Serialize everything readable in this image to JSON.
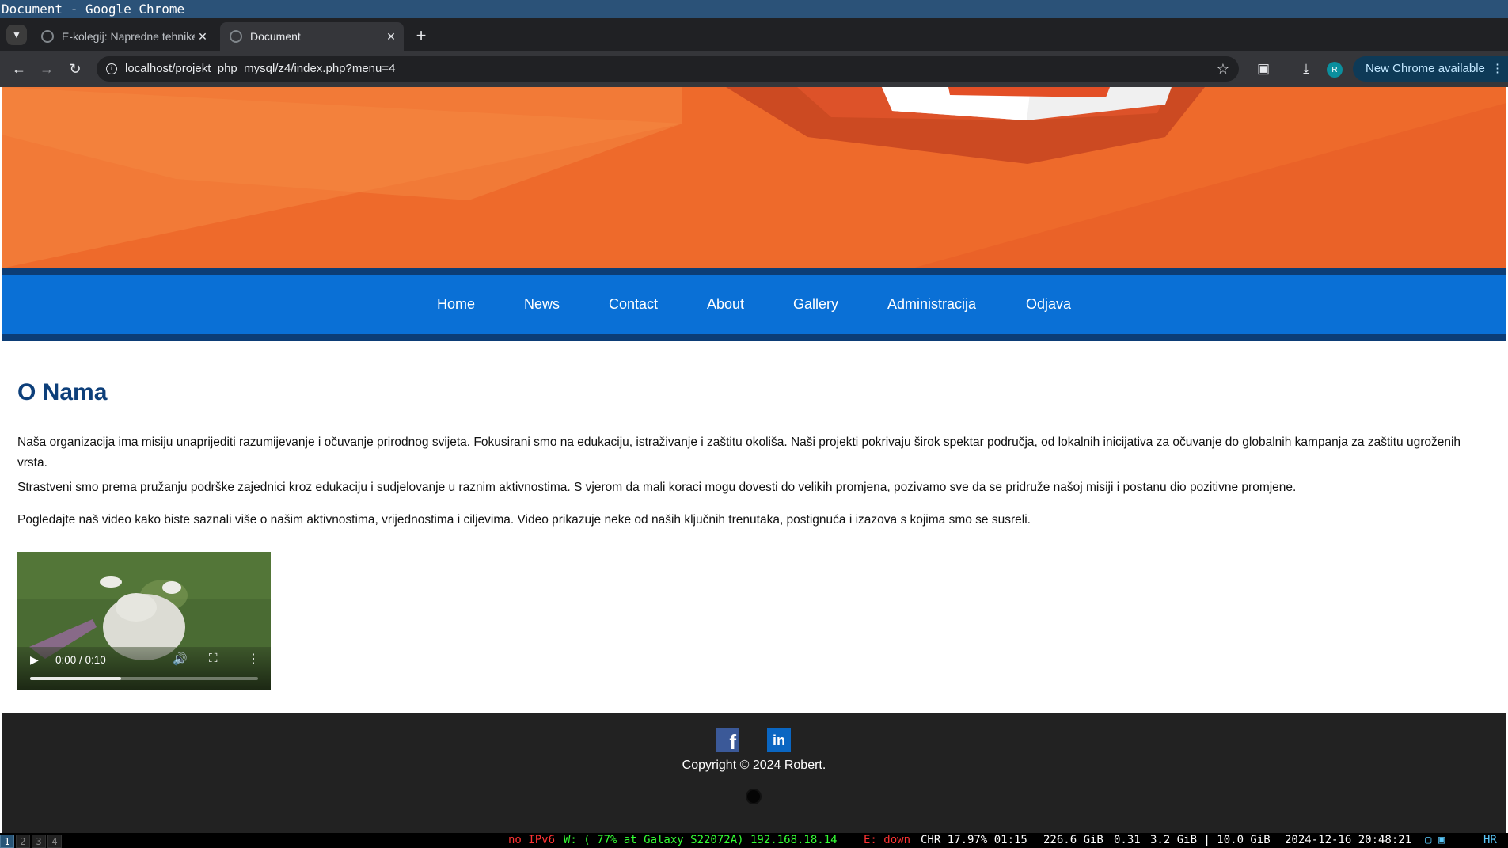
{
  "window": {
    "title": "Document - Google Chrome"
  },
  "tabs": [
    {
      "label": "E-kolegij: Napredne tehnike"
    },
    {
      "label": "Document"
    }
  ],
  "toolbar": {
    "url": "localhost/projekt_php_mysql/z4/index.php?menu=4",
    "profile_initial": "R",
    "update_label": "New Chrome available"
  },
  "nav": {
    "items": [
      "Home",
      "News",
      "Contact",
      "About",
      "Gallery",
      "Administracija",
      "Odjava"
    ]
  },
  "main": {
    "heading": "O Nama",
    "paragraphs": [
      "Naša organizacija ima misiju unaprijediti razumijevanje i očuvanje prirodnog svijeta. Fokusirani smo na edukaciju, istraživanje i zaštitu okoliša. Naši projekti pokrivaju širok spektar područja, od lokalnih inicijativa za očuvanje do globalnih kampanja za zaštitu ugroženih vrsta.",
      "Strastveni smo prema pružanju podrške zajednici kroz edukaciju i sudjelovanje u raznim aktivnostima. S vjerom da mali koraci mogu dovesti do velikih promjena, pozivamo sve da se pridruže našoj misiji i postanu dio pozitivne promjene.",
      "Pogledajte naš video kako biste saznali više o našim aktivnostima, vrijednostima i ciljevima. Video prikazuje neke od naših ključnih trenutaka, postignuća i izazova s kojima smo se susreli."
    ],
    "video": {
      "time": "0:00 / 0:10",
      "buffered_fraction": 0.4
    }
  },
  "footer": {
    "copyright": "Copyright © 2024 Robert.",
    "social_icons": [
      "facebook-icon",
      "linkedin-icon",
      "github-icon"
    ]
  },
  "statusbar": {
    "workspaces": [
      "1",
      "2",
      "3",
      "4"
    ],
    "ipv6": "no IPv6",
    "wifi": "W: ( 77% at Galaxy S22072A) 192.168.18.14",
    "ethernet": "E: down",
    "battery": "CHR 17.97% 01:15",
    "disk": "226.6 GiB",
    "load": "0.31",
    "memory": "3.2 GiB | 10.0 GiB",
    "datetime": "2024-12-16 20:48:21",
    "layout": "HR"
  },
  "colors": {
    "hero_orange": "#ee6a2b",
    "nav_blue": "#0a70d6",
    "nav_dark": "#0c3d76",
    "heading_blue": "#0d3f7a",
    "footer_bg": "#222222"
  }
}
